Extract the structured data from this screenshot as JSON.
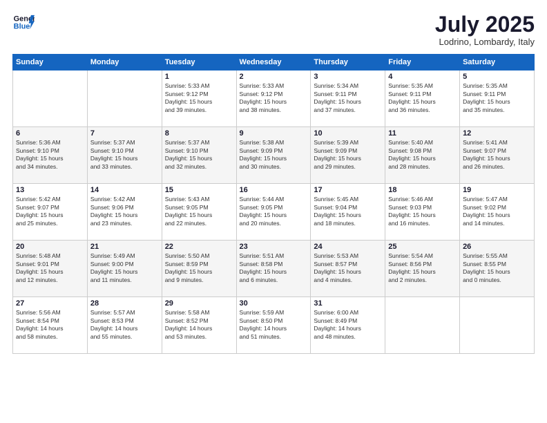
{
  "logo": {
    "line1": "General",
    "line2": "Blue"
  },
  "title": "July 2025",
  "location": "Lodrino, Lombardy, Italy",
  "weekdays": [
    "Sunday",
    "Monday",
    "Tuesday",
    "Wednesday",
    "Thursday",
    "Friday",
    "Saturday"
  ],
  "weeks": [
    [
      {
        "day": "",
        "info": ""
      },
      {
        "day": "",
        "info": ""
      },
      {
        "day": "1",
        "info": "Sunrise: 5:33 AM\nSunset: 9:12 PM\nDaylight: 15 hours\nand 39 minutes."
      },
      {
        "day": "2",
        "info": "Sunrise: 5:33 AM\nSunset: 9:12 PM\nDaylight: 15 hours\nand 38 minutes."
      },
      {
        "day": "3",
        "info": "Sunrise: 5:34 AM\nSunset: 9:11 PM\nDaylight: 15 hours\nand 37 minutes."
      },
      {
        "day": "4",
        "info": "Sunrise: 5:35 AM\nSunset: 9:11 PM\nDaylight: 15 hours\nand 36 minutes."
      },
      {
        "day": "5",
        "info": "Sunrise: 5:35 AM\nSunset: 9:11 PM\nDaylight: 15 hours\nand 35 minutes."
      }
    ],
    [
      {
        "day": "6",
        "info": "Sunrise: 5:36 AM\nSunset: 9:10 PM\nDaylight: 15 hours\nand 34 minutes."
      },
      {
        "day": "7",
        "info": "Sunrise: 5:37 AM\nSunset: 9:10 PM\nDaylight: 15 hours\nand 33 minutes."
      },
      {
        "day": "8",
        "info": "Sunrise: 5:37 AM\nSunset: 9:10 PM\nDaylight: 15 hours\nand 32 minutes."
      },
      {
        "day": "9",
        "info": "Sunrise: 5:38 AM\nSunset: 9:09 PM\nDaylight: 15 hours\nand 30 minutes."
      },
      {
        "day": "10",
        "info": "Sunrise: 5:39 AM\nSunset: 9:09 PM\nDaylight: 15 hours\nand 29 minutes."
      },
      {
        "day": "11",
        "info": "Sunrise: 5:40 AM\nSunset: 9:08 PM\nDaylight: 15 hours\nand 28 minutes."
      },
      {
        "day": "12",
        "info": "Sunrise: 5:41 AM\nSunset: 9:07 PM\nDaylight: 15 hours\nand 26 minutes."
      }
    ],
    [
      {
        "day": "13",
        "info": "Sunrise: 5:42 AM\nSunset: 9:07 PM\nDaylight: 15 hours\nand 25 minutes."
      },
      {
        "day": "14",
        "info": "Sunrise: 5:42 AM\nSunset: 9:06 PM\nDaylight: 15 hours\nand 23 minutes."
      },
      {
        "day": "15",
        "info": "Sunrise: 5:43 AM\nSunset: 9:05 PM\nDaylight: 15 hours\nand 22 minutes."
      },
      {
        "day": "16",
        "info": "Sunrise: 5:44 AM\nSunset: 9:05 PM\nDaylight: 15 hours\nand 20 minutes."
      },
      {
        "day": "17",
        "info": "Sunrise: 5:45 AM\nSunset: 9:04 PM\nDaylight: 15 hours\nand 18 minutes."
      },
      {
        "day": "18",
        "info": "Sunrise: 5:46 AM\nSunset: 9:03 PM\nDaylight: 15 hours\nand 16 minutes."
      },
      {
        "day": "19",
        "info": "Sunrise: 5:47 AM\nSunset: 9:02 PM\nDaylight: 15 hours\nand 14 minutes."
      }
    ],
    [
      {
        "day": "20",
        "info": "Sunrise: 5:48 AM\nSunset: 9:01 PM\nDaylight: 15 hours\nand 12 minutes."
      },
      {
        "day": "21",
        "info": "Sunrise: 5:49 AM\nSunset: 9:00 PM\nDaylight: 15 hours\nand 11 minutes."
      },
      {
        "day": "22",
        "info": "Sunrise: 5:50 AM\nSunset: 8:59 PM\nDaylight: 15 hours\nand 9 minutes."
      },
      {
        "day": "23",
        "info": "Sunrise: 5:51 AM\nSunset: 8:58 PM\nDaylight: 15 hours\nand 6 minutes."
      },
      {
        "day": "24",
        "info": "Sunrise: 5:53 AM\nSunset: 8:57 PM\nDaylight: 15 hours\nand 4 minutes."
      },
      {
        "day": "25",
        "info": "Sunrise: 5:54 AM\nSunset: 8:56 PM\nDaylight: 15 hours\nand 2 minutes."
      },
      {
        "day": "26",
        "info": "Sunrise: 5:55 AM\nSunset: 8:55 PM\nDaylight: 15 hours\nand 0 minutes."
      }
    ],
    [
      {
        "day": "27",
        "info": "Sunrise: 5:56 AM\nSunset: 8:54 PM\nDaylight: 14 hours\nand 58 minutes."
      },
      {
        "day": "28",
        "info": "Sunrise: 5:57 AM\nSunset: 8:53 PM\nDaylight: 14 hours\nand 55 minutes."
      },
      {
        "day": "29",
        "info": "Sunrise: 5:58 AM\nSunset: 8:52 PM\nDaylight: 14 hours\nand 53 minutes."
      },
      {
        "day": "30",
        "info": "Sunrise: 5:59 AM\nSunset: 8:50 PM\nDaylight: 14 hours\nand 51 minutes."
      },
      {
        "day": "31",
        "info": "Sunrise: 6:00 AM\nSunset: 8:49 PM\nDaylight: 14 hours\nand 48 minutes."
      },
      {
        "day": "",
        "info": ""
      },
      {
        "day": "",
        "info": ""
      }
    ]
  ]
}
